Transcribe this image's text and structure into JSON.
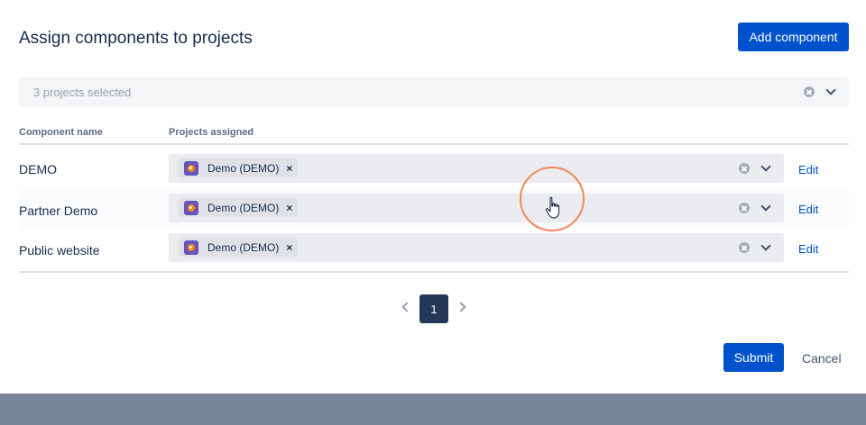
{
  "dialog": {
    "title": "Assign components to projects",
    "add_button_label": "Add component",
    "projects_filter": {
      "placeholder": "3 projects selected"
    },
    "table": {
      "headers": [
        "Component name",
        "Projects assigned"
      ],
      "rows": [
        {
          "name": "DEMO",
          "tag": "Demo (DEMO)",
          "action": "Edit"
        },
        {
          "name": "Partner Demo",
          "tag": "Demo (DEMO)",
          "action": "Edit"
        },
        {
          "name": "Public website",
          "tag": "Demo (DEMO)",
          "action": "Edit"
        }
      ]
    },
    "pagination": {
      "current_page": "1"
    },
    "submit_label": "Submit",
    "cancel_label": "Cancel"
  },
  "colors": {
    "primary": "#0052cc",
    "page_active": "#253858",
    "backdrop": "#7a8499",
    "cursor_ring": "#f2875c"
  },
  "icons": {
    "clear": "clear-icon",
    "dropdown": "chevron-down-icon",
    "project_avatar": "project-avatar-icon",
    "remove_tag": "remove-tag-icon",
    "cursor": "hand-cursor-icon"
  }
}
